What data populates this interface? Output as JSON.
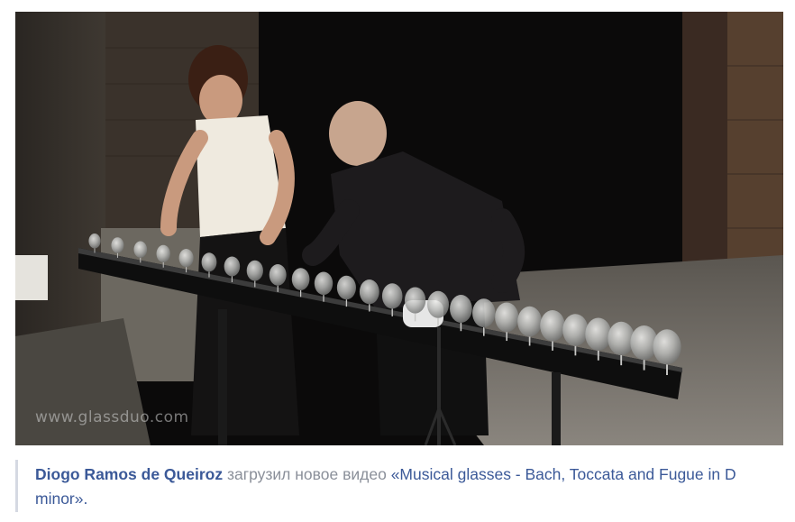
{
  "video": {
    "watermark": "www.glassduo.com",
    "icon": "video-thumbnail"
  },
  "post": {
    "author": "Diogo Ramos de Queiroz",
    "action": " загрузил новое видео ",
    "quote_open": "«",
    "video_title": "Musical glasses - Bach, Toccata and Fugue in D minor",
    "quote_close": "».",
    "colors": {
      "link": "#3b5998",
      "muted_text": "#8a8f99",
      "quote_border": "#d5d9e2"
    }
  }
}
